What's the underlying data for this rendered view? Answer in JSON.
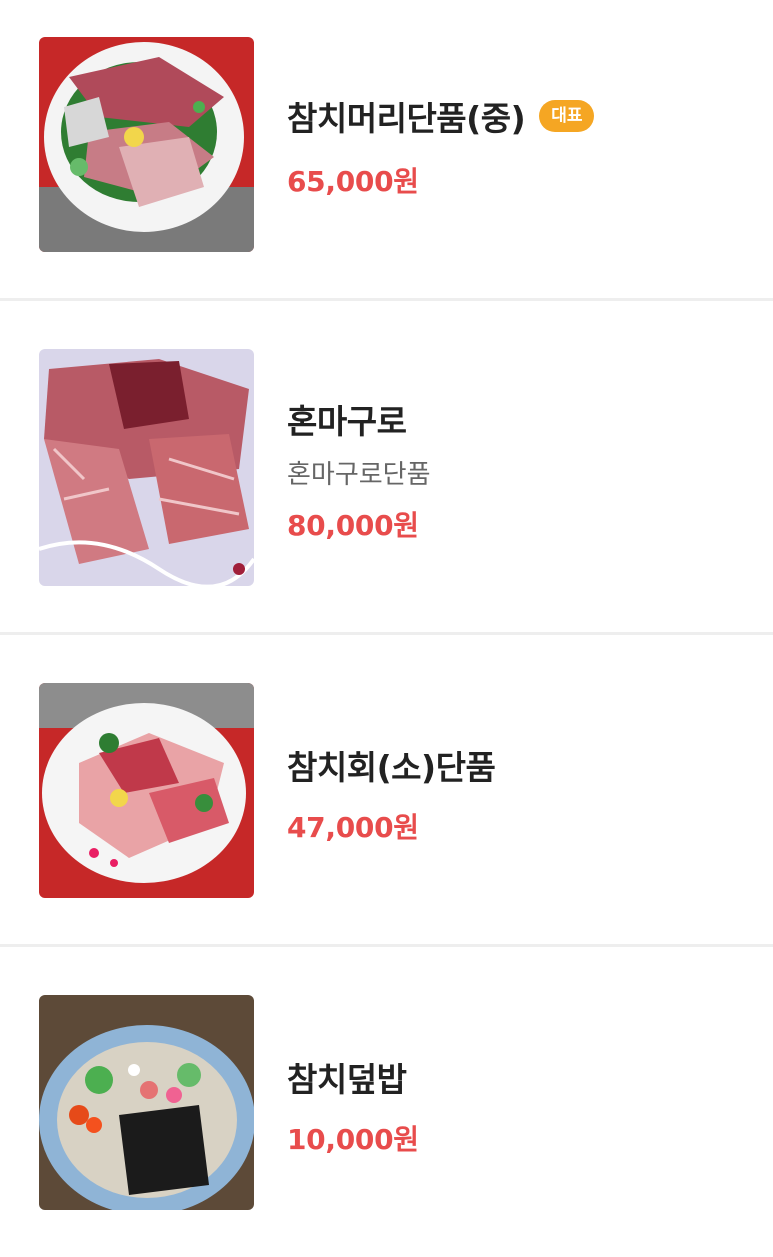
{
  "menu": {
    "items": [
      {
        "name": "참치머리단품(중)",
        "badge": "대표",
        "description": "",
        "price": "65,000원",
        "photo": "tuna-head-platter-photo"
      },
      {
        "name": "혼마구로",
        "badge": "",
        "description": "혼마구로단품",
        "price": "80,000원",
        "photo": "bluefin-tuna-sashimi-photo"
      },
      {
        "name": "참치회(소)단품",
        "badge": "",
        "description": "",
        "price": "47,000원",
        "photo": "tuna-sashimi-plate-photo"
      },
      {
        "name": "참치덮밥",
        "badge": "",
        "description": "",
        "price": "10,000원",
        "photo": "tuna-rice-bowl-photo"
      }
    ]
  },
  "colors": {
    "name_text": "#222222",
    "price_text": "#e84c4c",
    "description_text": "#666666",
    "badge_background": "#f5a623",
    "divider": "#eeeeee"
  }
}
